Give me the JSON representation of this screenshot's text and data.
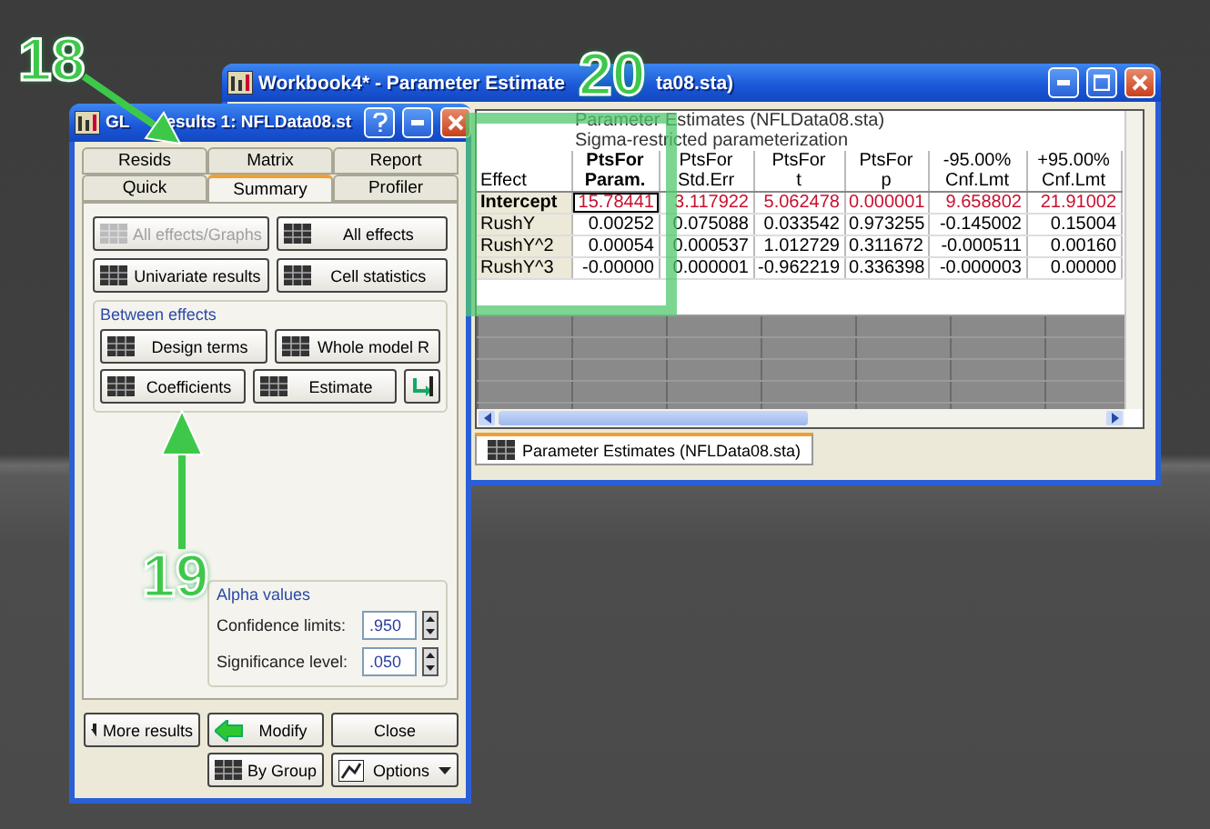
{
  "annotations": [
    {
      "label": "18"
    },
    {
      "label": "19"
    },
    {
      "label": "20"
    }
  ],
  "workbook": {
    "title_parts": [
      "Workbook4* - Parameter Estimate",
      "ta08.sta)"
    ],
    "table": {
      "title": "Parameter Estimates (NFLData08.sta)",
      "subtitle": "Sigma-restricted parameterization",
      "columns": [
        {
          "lines": [
            "Effect"
          ],
          "selected": false
        },
        {
          "lines": [
            "PtsFor",
            "Param."
          ],
          "selected": true
        },
        {
          "lines": [
            "PtsFor",
            "Std.Err"
          ],
          "selected": false
        },
        {
          "lines": [
            "PtsFor",
            "t"
          ],
          "selected": false
        },
        {
          "lines": [
            "PtsFor",
            "p"
          ],
          "selected": false
        },
        {
          "lines": [
            "-95.00%",
            "Cnf.Lmt"
          ],
          "selected": false
        },
        {
          "lines": [
            "+95.00%",
            "Cnf.Lmt"
          ],
          "selected": false
        }
      ],
      "rows": [
        {
          "selected": true,
          "significant": true,
          "cells": [
            "Intercept",
            "15.78441",
            "3.117922",
            "5.062478",
            "0.000001",
            "9.658802",
            "21.91002"
          ]
        },
        {
          "selected": false,
          "significant": false,
          "cells": [
            "RushY",
            "0.00252",
            "0.075088",
            "0.033542",
            "0.973255",
            "-0.145002",
            "0.15004"
          ]
        },
        {
          "selected": false,
          "significant": false,
          "cells": [
            "RushY^2",
            "0.00054",
            "0.000537",
            "1.012729",
            "0.311672",
            "-0.000511",
            "0.00160"
          ]
        },
        {
          "selected": false,
          "significant": false,
          "cells": [
            "RushY^3",
            "-0.00000",
            "0.000001",
            "-0.962219",
            "0.336398",
            "-0.000003",
            "0.00000"
          ]
        }
      ]
    },
    "sheet_tab": "Parameter Estimates (NFLData08.sta)"
  },
  "glm": {
    "title_parts": [
      "GL",
      "esults 1: NFLData08.st"
    ],
    "tab_rows": [
      {
        "tabs": [
          {
            "label": "Resids",
            "selected": false
          },
          {
            "label": "Matrix",
            "selected": false
          },
          {
            "label": "Report",
            "selected": false
          }
        ]
      },
      {
        "tabs": [
          {
            "label": "Quick",
            "selected": false
          },
          {
            "label": "Summary",
            "selected": true
          },
          {
            "label": "Profiler",
            "selected": false
          }
        ]
      }
    ],
    "buttons": [
      {
        "label": "All effects/Graphs",
        "disabled": true
      },
      {
        "label": "All effects",
        "disabled": false
      },
      {
        "label": "Univariate results",
        "disabled": false
      },
      {
        "label": "Cell statistics",
        "disabled": false
      }
    ],
    "group_label": "Between effects",
    "effect_buttons": [
      {
        "label": "Design terms"
      },
      {
        "label": "Whole model R"
      },
      {
        "label": "Coefficients"
      },
      {
        "label": "Estimate"
      }
    ],
    "alpha": {
      "label": "Alpha values",
      "fields": [
        {
          "label": "Confidence limits:",
          "value": ".950"
        },
        {
          "label": "Significance level:",
          "value": ".050"
        }
      ]
    },
    "footer_buttons": [
      {
        "kind": "more",
        "label": "More results"
      },
      {
        "kind": "modify",
        "label": "Modify"
      },
      {
        "kind": "plain",
        "label": "Close"
      }
    ],
    "footer_buttons_2": [
      {
        "kind": "group",
        "label": "By Group"
      },
      {
        "kind": "options",
        "label": "Options"
      }
    ]
  }
}
